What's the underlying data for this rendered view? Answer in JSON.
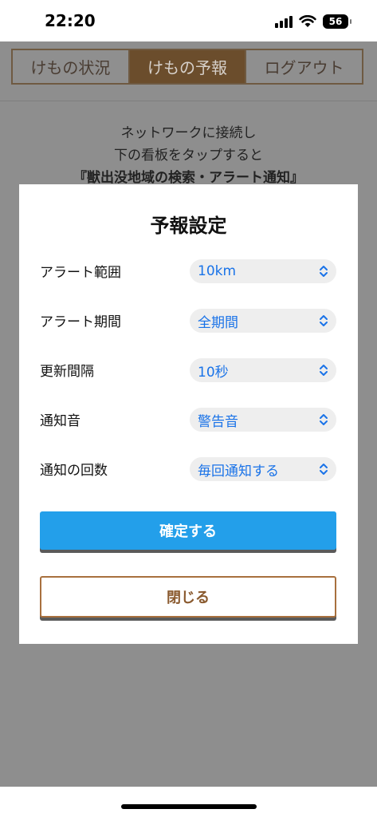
{
  "status_bar": {
    "time": "22:20",
    "battery": "56"
  },
  "nav": {
    "tabs": [
      {
        "label": "けもの状況",
        "active": false
      },
      {
        "label": "けもの予報",
        "active": true
      },
      {
        "label": "ログアウト",
        "active": false
      }
    ]
  },
  "instructions": {
    "line1": "ネットワークに接続し",
    "line2": "下の看板をタップすると",
    "line3": "『獣出没地域の検索・アラート通知』"
  },
  "modal": {
    "title": "予報設定",
    "settings": [
      {
        "label": "アラート範囲",
        "value": "10km"
      },
      {
        "label": "アラート期間",
        "value": "全期間"
      },
      {
        "label": "更新間隔",
        "value": "10秒"
      },
      {
        "label": "通知音",
        "value": "警告音"
      },
      {
        "label": "通知の回数",
        "value": "毎回通知する"
      }
    ],
    "confirm_label": "確定する",
    "close_label": "閉じる"
  },
  "colors": {
    "accent_blue": "#239fea",
    "brown": "#8a5a2f",
    "overlay": "#8e8e8e"
  }
}
